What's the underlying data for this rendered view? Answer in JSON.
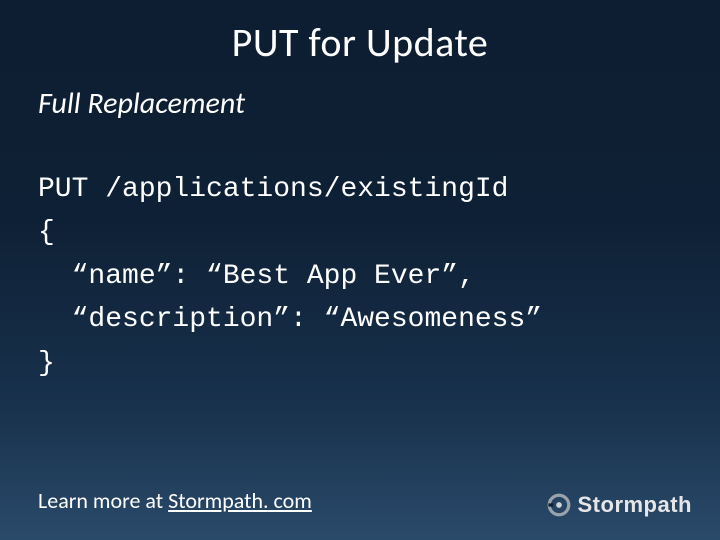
{
  "title": "PUT for Update",
  "subtitle": "Full Replacement",
  "code": {
    "line1": "PUT /applications/existingId",
    "line2": "{",
    "line3": "  “name”: “Best App Ever”,",
    "line4": "  “description”: “Awesomeness”",
    "line5": "}"
  },
  "footer": {
    "prefix": "Learn more at ",
    "domain": "Stormpath. com"
  },
  "logo": {
    "text": "Stormpath",
    "icon_name": "stormpath-logo-icon"
  }
}
